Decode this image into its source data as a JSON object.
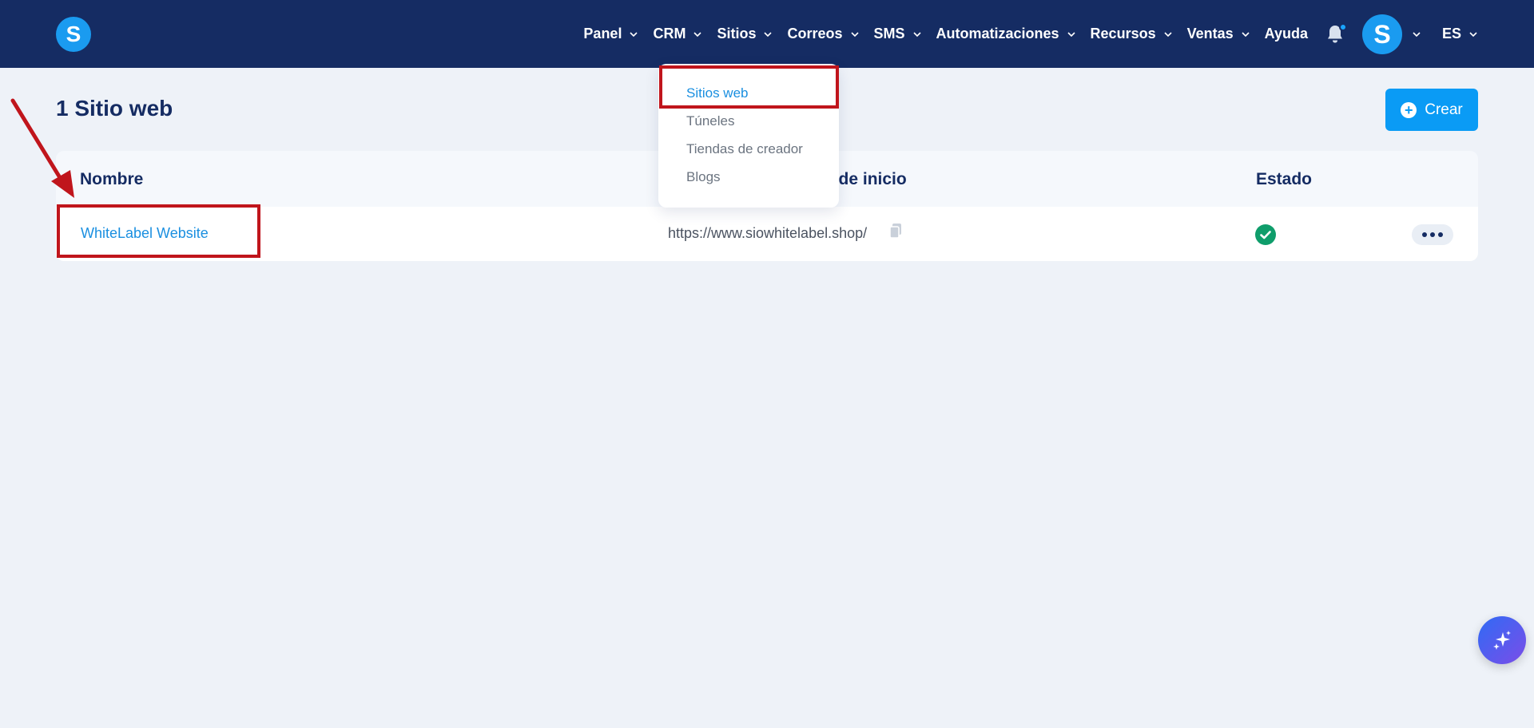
{
  "app": {
    "logo_letter": "S",
    "brand_color": "#1a9bf0",
    "navbar_color": "#152c63"
  },
  "nav": {
    "items": [
      {
        "label": "Panel",
        "has_dropdown": true
      },
      {
        "label": "CRM",
        "has_dropdown": true
      },
      {
        "label": "Sitios",
        "has_dropdown": true
      },
      {
        "label": "Correos",
        "has_dropdown": true
      },
      {
        "label": "SMS",
        "has_dropdown": true
      },
      {
        "label": "Automatizaciones",
        "has_dropdown": true
      },
      {
        "label": "Recursos",
        "has_dropdown": true
      },
      {
        "label": "Ventas",
        "has_dropdown": true
      },
      {
        "label": "Ayuda",
        "has_dropdown": false
      }
    ],
    "notification_icon": "bell-icon",
    "avatar_letter": "S",
    "language": "ES"
  },
  "sitios_dropdown": {
    "items": [
      {
        "label": "Sitios web",
        "active": true
      },
      {
        "label": "Túneles",
        "active": false
      },
      {
        "label": "Tiendas de creador",
        "active": false
      },
      {
        "label": "Blogs",
        "active": false
      }
    ]
  },
  "page": {
    "title": "1 Sitio web",
    "create_label": "Crear"
  },
  "table": {
    "columns": [
      "Nombre",
      "a de inicio",
      "Estado"
    ],
    "rows": [
      {
        "name": "WhiteLabel Website",
        "url": "https://www.siowhitelabel.shop/",
        "status_icon": "check-circle-icon",
        "status_color": "#0f9d6b"
      }
    ]
  },
  "annotations": {
    "highlight_color": "#c0151c"
  }
}
